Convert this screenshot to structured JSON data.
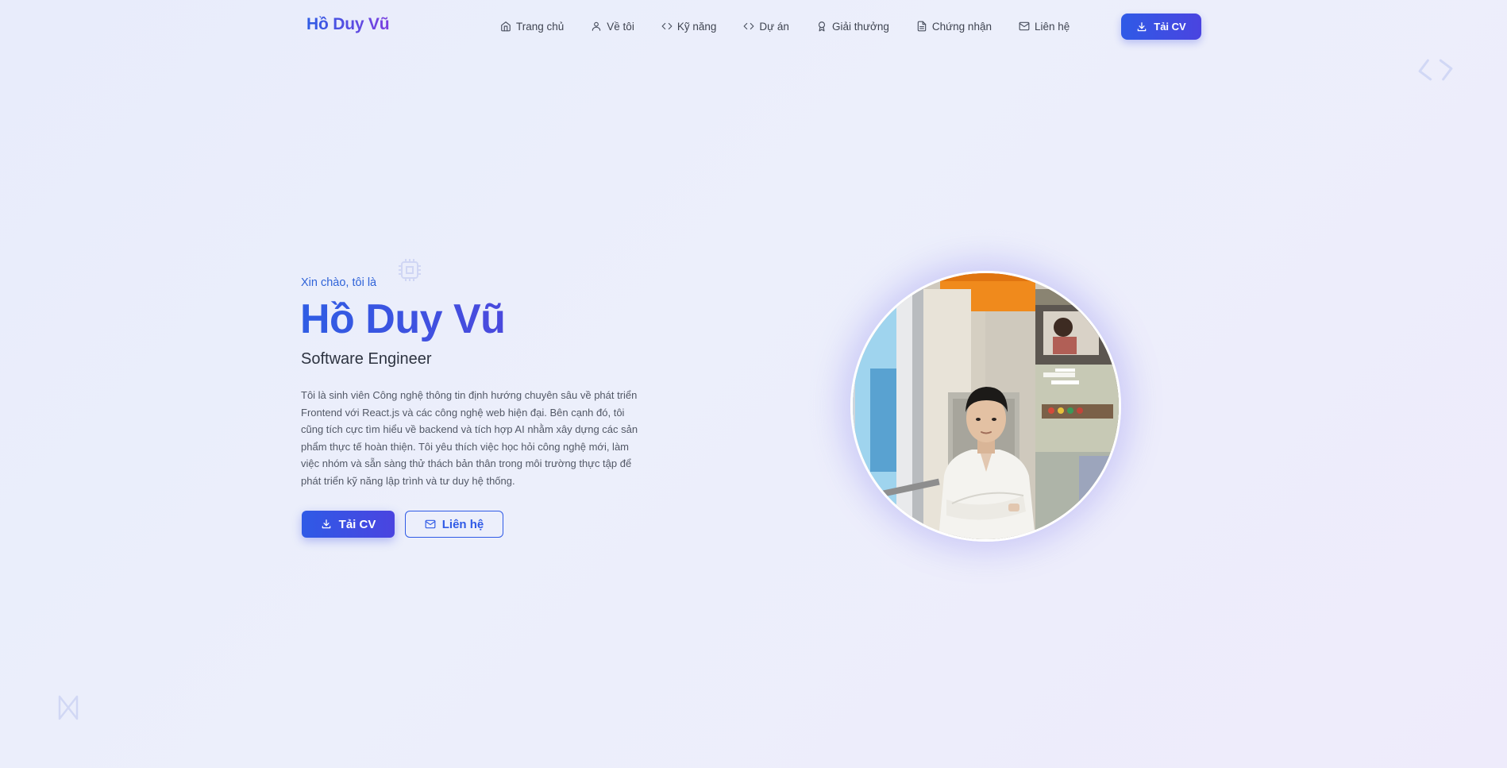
{
  "header": {
    "logo": "Hồ Duy Vũ",
    "nav": [
      {
        "label": "Trang chủ",
        "icon": "home-icon"
      },
      {
        "label": "Về tôi",
        "icon": "user-icon"
      },
      {
        "label": "Kỹ năng",
        "icon": "code-icon"
      },
      {
        "label": "Dự án",
        "icon": "code-icon"
      },
      {
        "label": "Giải thưởng",
        "icon": "award-icon"
      },
      {
        "label": "Chứng nhận",
        "icon": "document-icon"
      },
      {
        "label": "Liên hệ",
        "icon": "mail-icon"
      }
    ],
    "cv_button": "Tải CV"
  },
  "hero": {
    "greeting": "Xin chào, tôi là",
    "name": "Hồ Duy Vũ",
    "role": "Software Engineer",
    "description": "Tôi là sinh viên Công nghệ thông tin định hướng chuyên sâu về phát triển Frontend với React.js và các công nghệ web hiện đại. Bên cạnh đó, tôi cũng tích cực tìm hiểu về backend và tích hợp AI nhằm xây dựng các sản phẩm thực tế hoàn thiện. Tôi yêu thích việc học hỏi công nghệ mới, làm việc nhóm và sẵn sàng thử thách bản thân trong môi trường thực tập để phát triển kỹ năng lập trình và tư duy hệ thống.",
    "primary_button": "Tải CV",
    "secondary_button": "Liên hệ"
  },
  "colors": {
    "accent": "#2f5ae6",
    "accent_secondary": "#4a44e0",
    "background": "#eaedfb"
  }
}
